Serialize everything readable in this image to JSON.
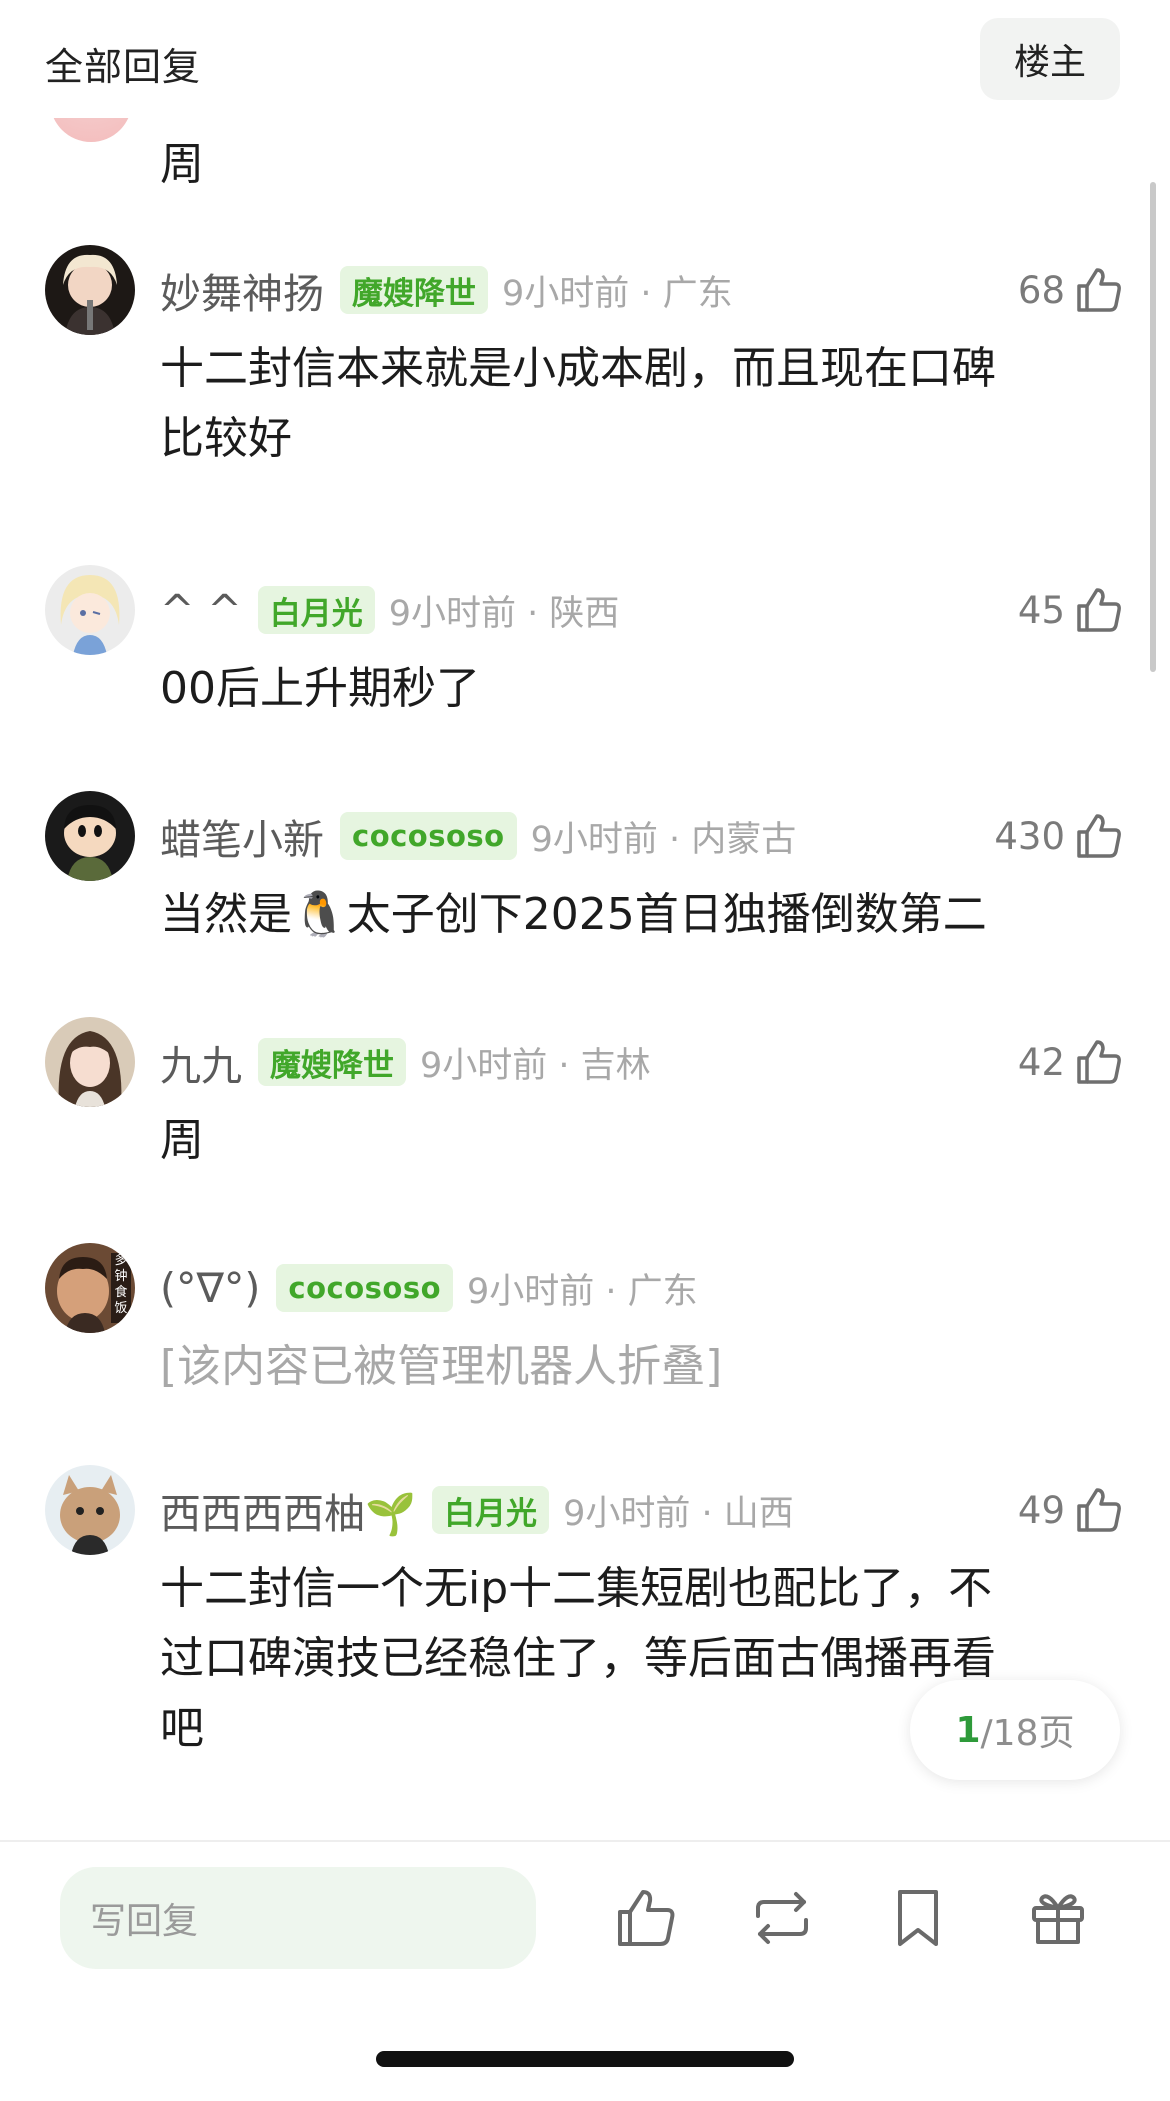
{
  "header": {
    "title": "全部回复",
    "op_label": "楼主"
  },
  "top_partial": {
    "text": "周"
  },
  "comments": [
    {
      "name": "妙舞神扬",
      "badge": "魔嫂降世",
      "time": "9小时前 · 广东",
      "likes": "68",
      "lines": [
        "十二封信本来就是小成本剧，而且现在口碑",
        "比较好"
      ]
    },
    {
      "name": "^ ^",
      "badge": "白月光",
      "time": "9小时前 · 陕西",
      "likes": "45",
      "lines": [
        "00后上升期秒了"
      ]
    },
    {
      "name": "蜡笔小新",
      "badge": "cocososo",
      "time": "9小时前 · 内蒙古",
      "likes": "430",
      "lines": [
        "当然是🐧太子创下2025首日独播倒数第二"
      ]
    },
    {
      "name": "九九",
      "badge": "魔嫂降世",
      "time": "9小时前 · 吉林",
      "likes": "42",
      "lines": [
        "周"
      ]
    },
    {
      "name": "(°∇°)",
      "badge": "cocososo",
      "time": "9小时前 · 广东",
      "likes": "",
      "lines": [
        "[该内容已被管理机器人折叠]"
      ]
    },
    {
      "name": "西西西西柚🌱",
      "badge": "白月光",
      "time": "9小时前 · 山西",
      "likes": "49",
      "lines": [
        "十二封信一个无ip十二集短剧也配比了，不",
        "过口碑演技已经稳住了，等后面古偶播再看",
        "吧"
      ]
    }
  ],
  "pagination": {
    "current": "1",
    "total": "/18页"
  },
  "reply": {
    "placeholder": "写回复"
  },
  "avatar_text": "多钟食饭",
  "icons": [
    "thumbs-up-icon",
    "repost-icon",
    "bookmark-icon",
    "gift-icon"
  ],
  "colors": {
    "accent_green": "#41a72a",
    "badge_bg": "#e6f5e0",
    "input_bg": "#eef6ee"
  }
}
